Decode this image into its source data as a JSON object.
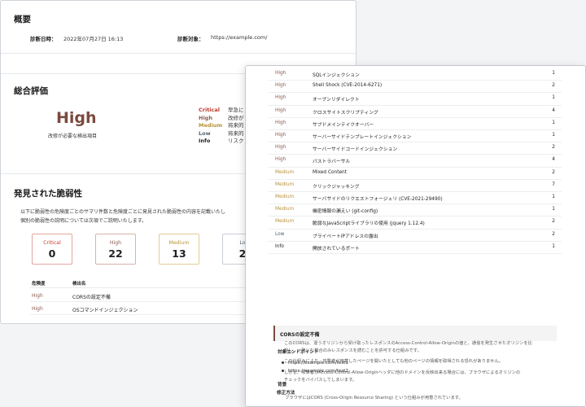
{
  "overview": {
    "title": "概要",
    "date_label": "診断日時：",
    "date_value": "2022年07月27日 16:13",
    "target_label": "診断対象：",
    "target_value": "https://example.com/"
  },
  "evaluation": {
    "title": "総合評価",
    "grade": "High",
    "grade_note": "改修が必要な検出項目",
    "legend": [
      {
        "label": "Critical",
        "desc": "早急に",
        "level": "critical"
      },
      {
        "label": "High",
        "desc": "改修が",
        "level": "high"
      },
      {
        "label": "Medium",
        "desc": "将来的",
        "level": "medium"
      },
      {
        "label": "Low",
        "desc": "将来的",
        "level": "low"
      },
      {
        "label": "Info",
        "desc": "リスク",
        "level": "info"
      }
    ]
  },
  "vulns": {
    "title": "発見された脆弱性",
    "desc_line1": "以下に脆弱性の危険度ごとのサマリ件数と危険度ごとに発見された脆弱性の内容を記載いたし",
    "desc_line2": "個別の脆弱性の説明については次項でご説明いたします。",
    "cards": [
      {
        "label": "Critical",
        "value": "0",
        "level": "critical"
      },
      {
        "label": "High",
        "value": "22",
        "level": "high"
      },
      {
        "label": "Medium",
        "value": "13",
        "level": "medium"
      },
      {
        "label": "Lo",
        "value": "2",
        "level": "low"
      }
    ],
    "table_headers": {
      "severity": "危険度",
      "name": "検出名"
    },
    "rows": [
      {
        "severity": "High",
        "name": "CORSの設定不備"
      },
      {
        "severity": "High",
        "name": "OSコマンドインジェクション"
      }
    ]
  },
  "front_table": [
    {
      "severity": "High",
      "name": "SQLインジェクション",
      "count": "1",
      "level": "high"
    },
    {
      "severity": "High",
      "name": "Shell Shock (CVE-2014-6271)",
      "count": "2",
      "level": "high"
    },
    {
      "severity": "High",
      "name": "オープンリダイレクト",
      "count": "1",
      "level": "high"
    },
    {
      "severity": "High",
      "name": "クロスサイトスクリプティング",
      "count": "4",
      "level": "high"
    },
    {
      "severity": "High",
      "name": "サブドメインテイクオーバー",
      "count": "1",
      "level": "high"
    },
    {
      "severity": "High",
      "name": "サーバーサイドテンプレートインジェクション",
      "count": "1",
      "level": "high"
    },
    {
      "severity": "High",
      "name": "サーバーサイドコードインジェクション",
      "count": "2",
      "level": "high"
    },
    {
      "severity": "High",
      "name": "パストラバーサル",
      "count": "4",
      "level": "high"
    },
    {
      "severity": "Medium",
      "name": "Mixed Content",
      "count": "2",
      "level": "medium"
    },
    {
      "severity": "Medium",
      "name": "クリックジャッキング",
      "count": "7",
      "level": "medium"
    },
    {
      "severity": "Medium",
      "name": "サーバサイドのリクエストフォージェリ (CVE-2021-29490)",
      "count": "1",
      "level": "medium"
    },
    {
      "severity": "Medium",
      "name": "機密情報の漏えい (git-config)",
      "count": "1",
      "level": "medium"
    },
    {
      "severity": "Medium",
      "name": "脆弱なJavaScriptライブラリの使用 (jquery 1.12.4)",
      "count": "2",
      "level": "medium"
    },
    {
      "severity": "Low",
      "name": "プライベートIPアドレスの露出",
      "count": "2",
      "level": "low"
    },
    {
      "severity": "Info",
      "name": "開放されているポート",
      "count": "1",
      "level": "info"
    }
  ],
  "cors": {
    "title": "CORSの設定不備",
    "endpoints_label": "対象エンドポイント",
    "endpoints": [
      "https://example.com/test1",
      "https://example.com/test2"
    ],
    "background_label": "背景",
    "paragraphs": [
      "ブラウザにはCORS (Cross-Origin Resource Sharing) という仕組みが用意されています。",
      "このCORSは、違うオリジンから受け取ったレスポンスのAccess-Control-Allow-Originの値と、通信を発生させたオリジンを比",
      "較し、一致した場合のみレスポンスを読むことを許可する仕組みです。",
      "この仕組みにより、攻撃者が用意したページを開いたとしても他のページの情報を取得される恐れがありません。",
      "しかし、攻撃者がAccess-Control-Allow-Originヘッダに他のドメインを反映出来る場合には、ブラウザによるオリジンの",
      "チェックをバイパスしてしまいます。"
    ],
    "fix_label": "修正方法"
  },
  "colors": {
    "critical": "#c0392b",
    "high": "#8b5b4f",
    "medium": "#b89137",
    "low": "#556270",
    "accent": "#7b4a3e"
  }
}
